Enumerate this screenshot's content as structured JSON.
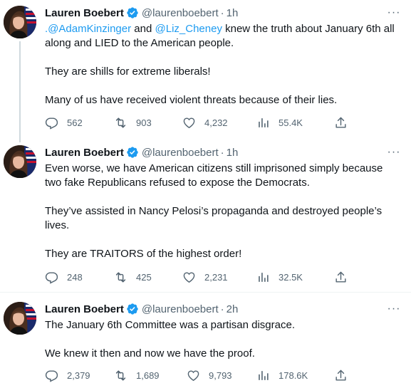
{
  "tweets": [
    {
      "name": "Lauren Boebert",
      "handle": "@laurenboebert",
      "time": "1h",
      "body": {
        "m1": ".@AdamKinzinger",
        "t1": " and ",
        "m2": "@Liz_Cheney",
        "t2": " knew the truth about January 6th all",
        "line2": "along and LIED to the American people.",
        "p2": "They are shills for extreme liberals!",
        "p3": "Many of us have received violent threats because of their lies."
      },
      "replies": "562",
      "retweets": "903",
      "likes": "4,232",
      "views": "55.4K"
    },
    {
      "name": "Lauren Boebert",
      "handle": "@laurenboebert",
      "time": "1h",
      "body": {
        "l1": "Even worse, we have American citizens still imprisoned simply because",
        "l2": "two fake Republicans refused to expose the Democrats.",
        "l3": "They’ve assisted in Nancy Pelosi’s propaganda and destroyed people’s",
        "l4": "lives.",
        "l5": "They are TRAITORS of the highest order!"
      },
      "replies": "248",
      "retweets": "425",
      "likes": "2,231",
      "views": "32.5K"
    },
    {
      "name": "Lauren Boebert",
      "handle": "@laurenboebert",
      "time": "2h",
      "body": {
        "l1": "The January 6th Committee was a partisan disgrace.",
        "l2": "We knew it then and now we have the proof."
      },
      "replies": "2,379",
      "retweets": "1,689",
      "likes": "9,793",
      "views": "178.6K"
    }
  ],
  "ui": {
    "dot": "·",
    "more": "···"
  },
  "icons": {
    "verified": "verified-badge-icon",
    "reply": "reply-icon",
    "retweet": "retweet-icon",
    "like": "heart-icon",
    "views": "views-icon",
    "share": "share-icon",
    "more": "more-icon"
  },
  "colors": {
    "accent": "#1d9bf0",
    "muted": "#536471",
    "text": "#0f1419"
  }
}
